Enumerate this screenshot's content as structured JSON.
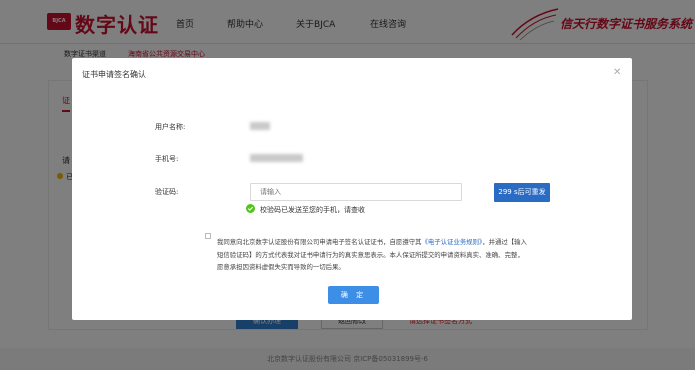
{
  "header": {
    "logo_badge": "BJCA",
    "logo_text": "数字认证",
    "nav": [
      "首页",
      "帮助中心",
      "关于BJCA",
      "在线咨询"
    ],
    "slogan": "信天行数字证书服务系统"
  },
  "breadcrumb": {
    "text": "数字证书渠道",
    "link": "海南省公共资源交易中心"
  },
  "background": {
    "tab1": "证",
    "tab2": "请",
    "row": "已",
    "btn1": "确认办理",
    "btn2": "返回修改",
    "warn": "请选择证书签名方式"
  },
  "footer": {
    "text": "北京数字认证股份有限公司 京ICP备05031899号-6"
  },
  "modal": {
    "title": "证书申请签名确认",
    "close_icon": "close-icon",
    "username_label": "用户名称:",
    "phone_label": "手机号:",
    "code_label": "验证码:",
    "code_placeholder": "请输入",
    "resend_button": "299 s后可重发",
    "sent_message": "校验码已发送至您的手机，请查收",
    "agree_prefix": "我同意向北京数字认证股份有限公司申请电子签名认证证书，自愿遵守其",
    "agree_link": "《电子认证业务规则》",
    "agree_suffix": "，并通过【输入短信验证码】的方式代表我对证书申请行为的真实意思表示。本人保证所提交的申请资料真实、准确、完整，愿意承担因资料虚假失实而导致的一切后果。",
    "confirm_button": "确 定"
  },
  "colors": {
    "brand": "#c8102e",
    "primary": "#2a6bc4",
    "confirm": "#3c8ee6",
    "success": "#52c41a"
  }
}
